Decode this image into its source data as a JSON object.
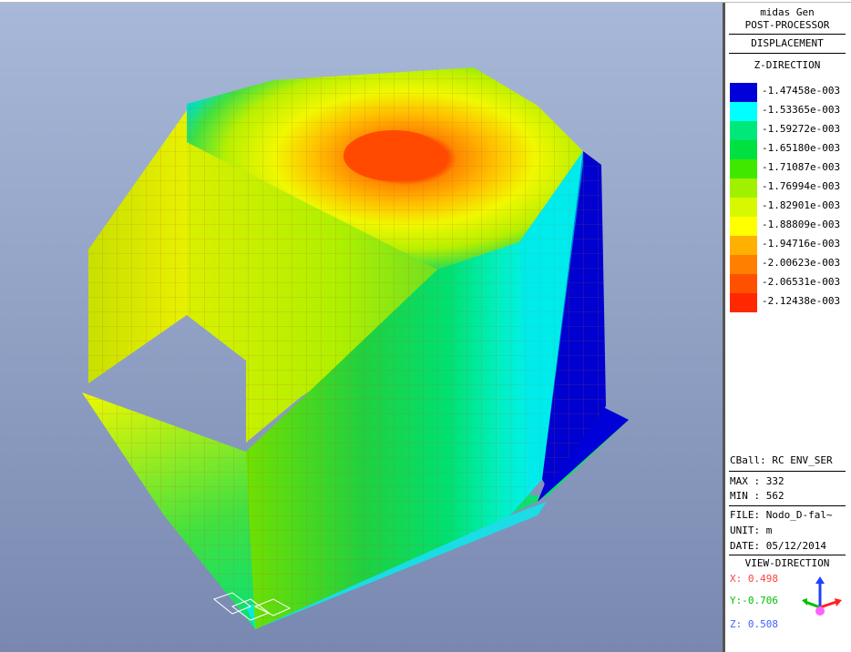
{
  "app": {
    "name": "midas Gen",
    "mode": "POST-PROCESSOR"
  },
  "result": {
    "type": "DISPLACEMENT",
    "component": "Z-DIRECTION"
  },
  "legend": [
    {
      "value": "-1.47458e-003",
      "color": "#0000d8"
    },
    {
      "value": "-1.53365e-003",
      "color": "#00ffff"
    },
    {
      "value": "-1.59272e-003",
      "color": "#00e87a"
    },
    {
      "value": "-1.65180e-003",
      "color": "#00e040"
    },
    {
      "value": "-1.71087e-003",
      "color": "#40e800"
    },
    {
      "value": "-1.76994e-003",
      "color": "#a0f000"
    },
    {
      "value": "-1.82901e-003",
      "color": "#d8f800"
    },
    {
      "value": "-1.88809e-003",
      "color": "#ffff00"
    },
    {
      "value": "-1.94716e-003",
      "color": "#ffb000"
    },
    {
      "value": "-2.00623e-003",
      "color": "#ff8000"
    },
    {
      "value": "-2.06531e-003",
      "color": "#ff5000"
    },
    {
      "value": "-2.12438e-003",
      "color": "#ff2800"
    }
  ],
  "info": {
    "cball": "CBall: RC ENV_SER",
    "max": "MAX : 332",
    "min": "MIN : 562",
    "file": "FILE: Nodo_D-fal~",
    "unit": "UNIT: m",
    "date": "DATE: 05/12/2014"
  },
  "view_direction": {
    "title": "VIEW-DIRECTION",
    "x": "X: 0.498",
    "y": "Y:-0.706",
    "z": "Z: 0.508",
    "x_color": "#ff4040",
    "y_color": "#00c000",
    "z_color": "#4060ff"
  }
}
